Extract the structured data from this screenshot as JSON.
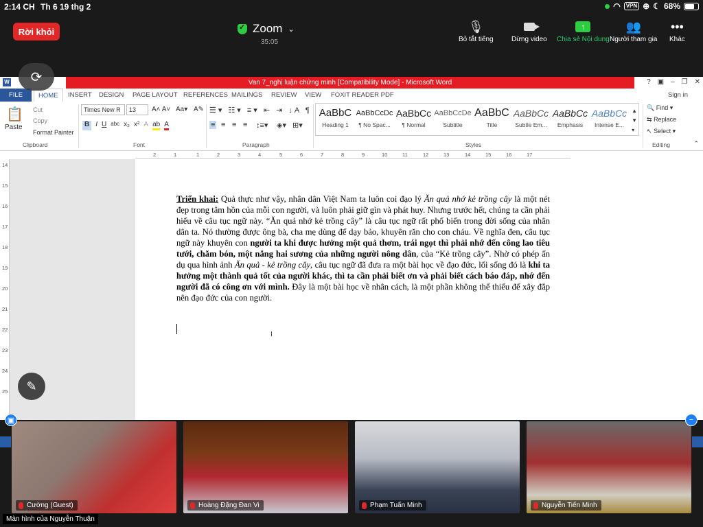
{
  "status": {
    "time": "2:14 CH",
    "date": "Th 6 19 thg 2",
    "vpn": "VPN",
    "battery": "68%"
  },
  "zoom": {
    "leave": "Rời khỏi",
    "title": "Zoom",
    "timer": "35:05",
    "tools": {
      "mute": "Bỏ tắt tiếng",
      "video": "Dừng video",
      "share": "Chia sẻ Nội dung",
      "participants": "Người tham gia",
      "more": "Khác"
    }
  },
  "word": {
    "window_title": "Van 7_nghị luận chứng minh [Compatibility Mode] -  Microsoft Word",
    "tabs": [
      "FILE",
      "HOME",
      "INSERT",
      "DESIGN",
      "PAGE LAYOUT",
      "REFERENCES",
      "MAILINGS",
      "REVIEW",
      "VIEW",
      "FOXIT READER PDF"
    ],
    "sign_in": "Sign in",
    "clipboard": {
      "paste": "Paste",
      "cut": "Cut",
      "copy": "Copy",
      "format_painter": "Format Painter",
      "label": "Clipboard"
    },
    "font": {
      "name": "Times New R",
      "size": "13",
      "label": "Font"
    },
    "paragraph_label": "Paragraph",
    "styles": [
      {
        "preview": "AaBbC",
        "name": "Heading 1"
      },
      {
        "preview": "AaBbCcDc",
        "name": "¶ No Spac..."
      },
      {
        "preview": "AaBbCc",
        "name": "¶ Normal"
      },
      {
        "preview": "AaBbCcDe",
        "name": "Subtitle"
      },
      {
        "preview": "AaBbC",
        "name": "Title"
      },
      {
        "preview": "AaBbCc",
        "name": "Subtle Em..."
      },
      {
        "preview": "AaBbCc",
        "name": "Emphasis"
      },
      {
        "preview": "AaBbCc",
        "name": "Intense E..."
      }
    ],
    "styles_label": "Styles",
    "editing": {
      "find": "Find",
      "replace": "Replace",
      "select": "Select",
      "label": "Editing"
    },
    "ruler_h": [
      "2",
      "1",
      "1",
      "2",
      "3",
      "4",
      "5",
      "6",
      "7",
      "8",
      "9",
      "10",
      "11",
      "12",
      "13",
      "14",
      "15",
      "16",
      "17"
    ],
    "ruler_v": [
      "14",
      "15",
      "16",
      "17",
      "18",
      "19",
      "20",
      "21",
      "22",
      "23",
      "24",
      "25"
    ],
    "doc": {
      "lead": "Triển khai:",
      "t1": " Quả thực như vậy, nhân dân Việt Nam ta luôn coi đạo lý ",
      "i1": "Ăn quả nhớ kẻ trồng cây",
      "t2": " là một nét đẹp trong tâm hồn của mỗi con người, và luôn phải giữ gìn và phát huy. Nhưng trước hết, chúng ta cần phải hiểu về câu tục ngữ này. “Ăn quả nhớ kẻ trồng cây” là câu tục ngữ rất phổ biến trong đời sống của nhân dân ta. Nó thường được ông bà, cha mẹ dùng để dạy bảo, khuyên răn cho con cháu. Về nghĩa đen, câu tục ngữ này khuyên con ",
      "b1": "người ta khi được hưởng một quả thơm, trái ngọt thì phải nhớ đến công lao tiêu tưới, chăm bón, một nắng hai sương của những người nông dân",
      "t3": ", của “Kẻ trồng cây”. Nhờ có phép ẩn dụ qua hình ảnh ",
      "i2": "Ăn quả - kẻ trồng cây",
      "t4": ", câu tục ngữ đã đưa ra một bài học về đạo đức, lối sống đó là ",
      "b2": "khi ta hưởng một thành quả tốt của người khác, thì ta cần phải biết ơn và phải biết cách báo đáp, nhớ đến người đã có công ơn với mình.",
      "t5": " Đây là một bài học về nhân cách, là một phần không thể thiếu để xây đắp nên đạo đức của con người."
    }
  },
  "participants": [
    {
      "name": "Cường (Guest)"
    },
    {
      "name": "Hoàng Đặng Đan Vi"
    },
    {
      "name": "Phạm Tuấn Minh"
    },
    {
      "name": "Nguyễn Tiến Minh"
    }
  ],
  "screen_owner": "Màn hình của Nguyễn Thuận",
  "colors": {
    "leave": "#e02828",
    "share_green": "#2ecc40",
    "word_red": "#e51c23",
    "word_blue": "#2b579a"
  }
}
